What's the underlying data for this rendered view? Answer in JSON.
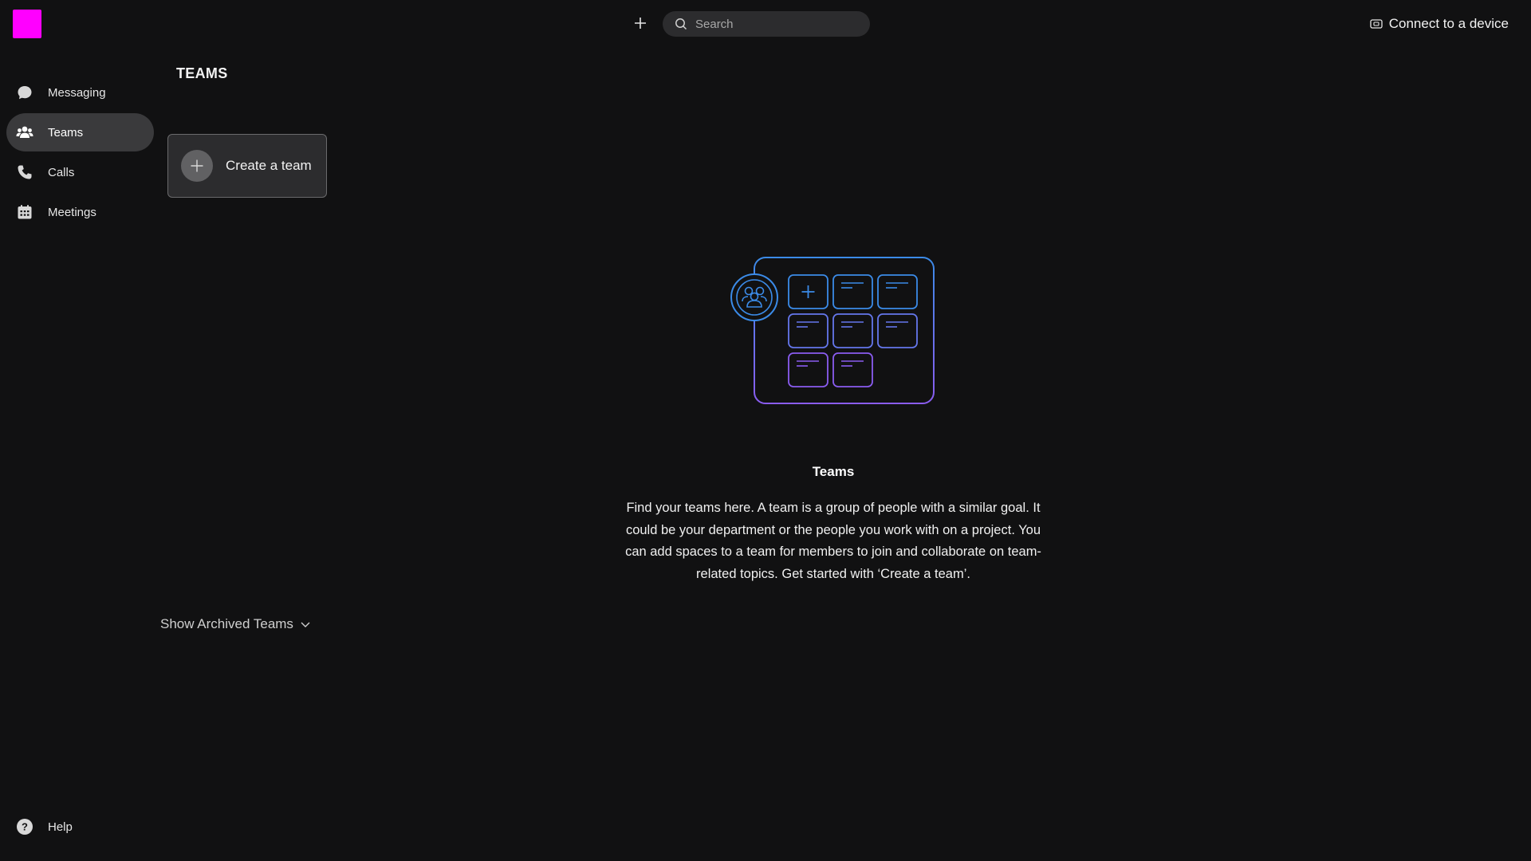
{
  "header": {
    "search_placeholder": "Search",
    "connect_label": "Connect to a device",
    "logo_color": "#ff00ff"
  },
  "sidebar": {
    "items": [
      {
        "label": "Messaging",
        "icon": "chat-bubble-icon",
        "active": false
      },
      {
        "label": "Teams",
        "icon": "people-icon",
        "active": true
      },
      {
        "label": "Calls",
        "icon": "phone-icon",
        "active": false
      },
      {
        "label": "Meetings",
        "icon": "calendar-icon",
        "active": false
      }
    ],
    "help_label": "Help"
  },
  "teams_panel": {
    "title": "TEAMS",
    "create_team_label": "Create a team",
    "archived_toggle_label": "Show Archived Teams"
  },
  "empty_state": {
    "title": "Teams",
    "description": "Find your teams here. A team is a group of people with a similar goal. It could be your department or the people you work with on a project. You can add spaces to a team for members to join and collaborate on team-related topics. Get started with ‘Create a team’.",
    "illustration": "teams-grid-illustration"
  },
  "colors": {
    "background": "#111112",
    "active_nav": "#3a3a3c",
    "illustration_blue": "#3b8be8",
    "illustration_purple": "#8a5cf0"
  }
}
